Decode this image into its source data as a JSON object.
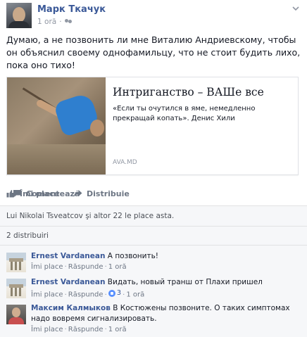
{
  "post": {
    "author": "Марк Ткачук",
    "time": "1 oră",
    "text": "Думаю, а не позвонить ли мне Виталию Андриевскому, чтобы он объяснил своему однофамильцу, что не стоит будить лихо, пока оно тихо!",
    "link": {
      "title": "Интриганство – ВАШе все",
      "description": "«Если ты очутился в яме, немедленно прекращай копать». Денис Хили",
      "source": "AVA.MD"
    }
  },
  "actions": {
    "like": "Îmi place",
    "comment": "Comentează",
    "share": "Distribuie"
  },
  "likes_summary": "Lui Nikolai Tsveatcov şi altor 22 le place asta.",
  "shares_summary": "2 distribuiri",
  "comments": [
    {
      "name": "Ernest Vardanean",
      "text": "А позвонить!",
      "like": "Îmi place",
      "reply": "Răspunde",
      "time": "1 oră",
      "likes": ""
    },
    {
      "name": "Ernest Vardanean",
      "text": "Видать, новый транш от Плахи пришел",
      "like": "Îmi place",
      "reply": "Răspunde",
      "time": "1 oră",
      "likes": "3"
    },
    {
      "name": "Максим Калмыков",
      "text": "В Костюжены позвоните. О таких симптомах надо вовремя сигнализировать.",
      "like": "Îmi place",
      "reply": "Răspunde",
      "time": "1 oră",
      "likes": ""
    }
  ],
  "colors": {
    "link": "#3b5998",
    "muted": "#9197a3",
    "panel": "#f6f7f9"
  }
}
